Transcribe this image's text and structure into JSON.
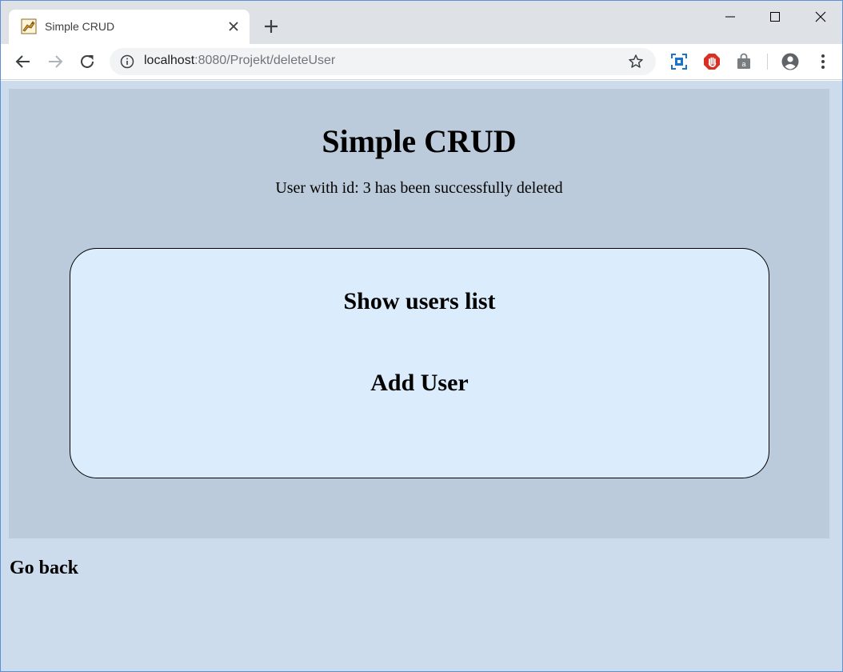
{
  "browser": {
    "tab": {
      "title": "Simple CRUD"
    },
    "address_bar": {
      "host": "localhost",
      "path": ":8080/Projekt/deleteUser"
    }
  },
  "page": {
    "title": "Simple CRUD",
    "message": "User with id: 3 has been successfully deleted",
    "menu": {
      "show_users": "Show users list",
      "add_user": "Add User"
    },
    "go_back": "Go back"
  },
  "colors": {
    "page_background": "#ccdcec",
    "panel_background": "#bccbdb",
    "menu_box_background": "#dbecfc",
    "tabstrip_background": "#dee1e6",
    "omnibox_background": "#f1f3f4"
  },
  "icons": {
    "tab_favicon": "tomcat-favicon-icon",
    "tab_close": "close-icon",
    "new_tab": "plus-icon",
    "info": "info-icon",
    "bookmark": "star-icon",
    "extension_1": "screen-capture-extension-icon",
    "extension_2": "adblock-hand-icon",
    "extension_3": "shopping-bag-icon",
    "profile": "account-circle-icon",
    "menu": "three-dots-vertical-icon"
  }
}
